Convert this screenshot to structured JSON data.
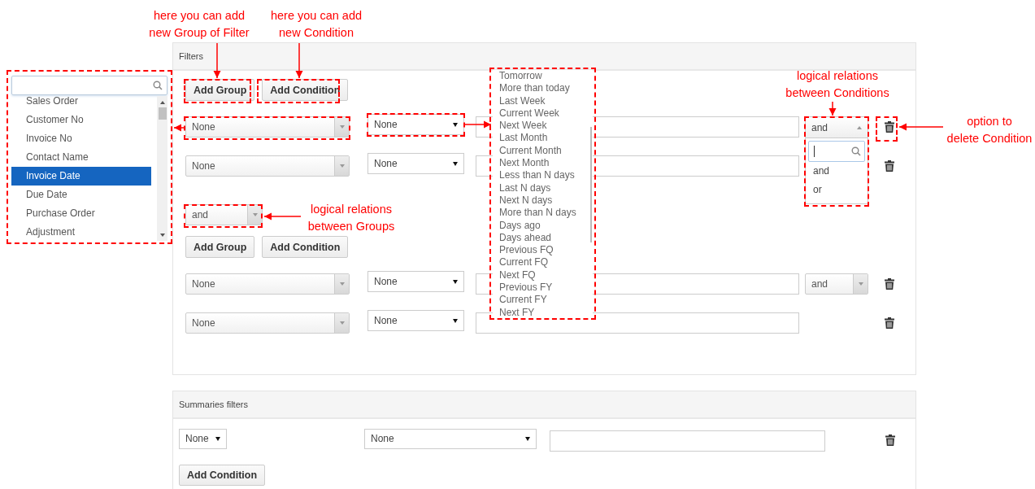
{
  "filters": {
    "title": "Filters",
    "buttons": [
      "Add Group",
      "Add Condition"
    ],
    "groups": [
      {
        "conditions": [
          {
            "field": "None",
            "operator": "None",
            "relation": {
              "value": "and",
              "expanded": true,
              "options": [
                "and",
                "or"
              ]
            }
          },
          {
            "field": "None",
            "operator": "None"
          }
        ]
      },
      {
        "relation": "and",
        "buttons": [
          "Add Group",
          "Add Condition"
        ],
        "conditions": [
          {
            "field": "None",
            "operator": "None",
            "relation": {
              "value": "and",
              "expanded": false
            }
          },
          {
            "field": "None",
            "operator": "None"
          }
        ]
      }
    ]
  },
  "summaries": {
    "title": "Summaries filters",
    "rows": [
      {
        "aggregate": "None",
        "field": "None"
      }
    ],
    "buttons": [
      "Add Condition"
    ]
  },
  "field_dropdown": {
    "items": [
      {
        "label": "Sales Order",
        "selected": false
      },
      {
        "label": "Customer No",
        "selected": false
      },
      {
        "label": "Invoice No",
        "selected": false
      },
      {
        "label": "Contact Name",
        "selected": false
      },
      {
        "label": "Invoice Date",
        "selected": true
      },
      {
        "label": "Due Date",
        "selected": false
      },
      {
        "label": "Purchase Order",
        "selected": false
      },
      {
        "label": "Adjustment",
        "selected": false
      }
    ]
  },
  "operator_list": {
    "items": [
      "Tomorrow",
      "More than today",
      "Last Week",
      "Current Week",
      "Next Week",
      "Last Month",
      "Current Month",
      "Next Month",
      "Less than N days",
      "Last N days",
      "Next N days",
      "More than N days",
      "Days ago",
      "Days ahead",
      "Previous FQ",
      "Current FQ",
      "Next FQ",
      "Previous FY",
      "Current FY",
      "Next FY"
    ]
  },
  "annotations": [
    "here you can add\nnew Group of Filter",
    "here you can add\nnew Condition",
    "logical relations\nbetween Conditions",
    "option to\ndelete Condition",
    "logical relations\nbetween Groups"
  ]
}
